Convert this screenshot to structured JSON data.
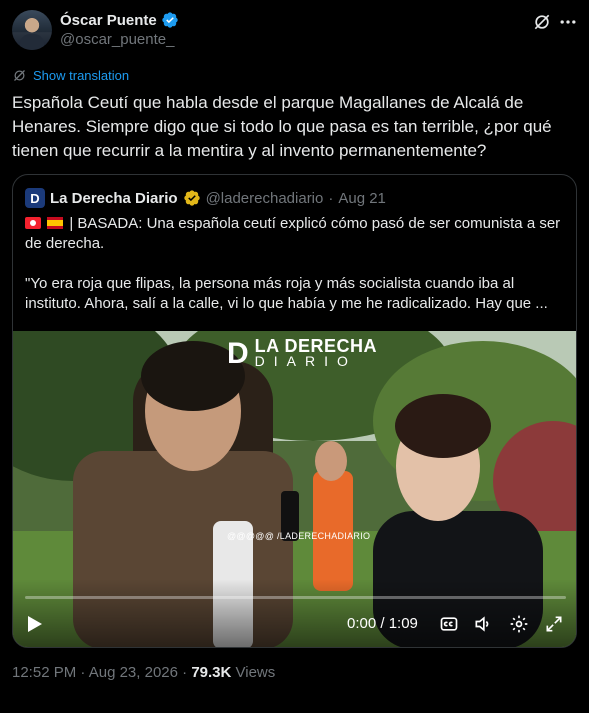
{
  "author": {
    "name": "Óscar Puente",
    "handle": "@oscar_puente_",
    "verified_color": "#1d9bf0"
  },
  "translate_label": "Show translation",
  "tweet_text": "Española Ceutí que habla desde el parque Magallanes de Alcalá de Henares. Siempre digo que si todo lo que pasa es tan terrible, ¿por qué tienen que recurrir a la mentira y al invento permanentemente?",
  "quote": {
    "logo_letter": "D",
    "name": "La Derecha Diario",
    "handle": "@laderechadiario",
    "dot": "·",
    "date": "Aug 21",
    "line1": "| BASADA: Una española ceutí explicó cómo pasó de ser comunista a ser de derecha.",
    "line2": "\"Yo era roja que flipas, la persona más roja y más socialista cuando iba al instituto. Ahora, salí a la calle, vi lo que había y me he radicalizado. Hay que ...",
    "video": {
      "watermark_letter": "D",
      "watermark_top": "LA DERECHA",
      "watermark_bottom": "DIARIO",
      "social_handle": "@@@@@ /LADERECHADIARIO",
      "time": "0:00 / 1:09",
      "progress": 0
    }
  },
  "meta": {
    "time": "12:52 PM",
    "sep1": " · ",
    "date": "Aug 23, 2026",
    "sep2": " · ",
    "views_count": "79.3K",
    "views_label": " Views"
  },
  "icons": {
    "grok": "grok-icon",
    "more": "more-horizontal-icon",
    "translate": "translate-icon",
    "play": "play-icon",
    "cc": "captions-icon",
    "volume": "volume-icon",
    "settings": "settings-icon",
    "fullscreen": "fullscreen-icon"
  }
}
